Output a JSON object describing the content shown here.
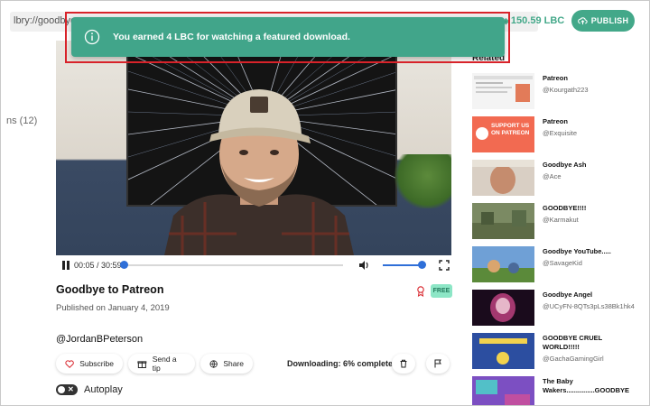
{
  "header": {
    "url": "lbry://goodbye",
    "balance": "150.59 LBC",
    "publish_label": "PUBLISH"
  },
  "sidebar": {
    "count_text": "ns (12)"
  },
  "toast": {
    "message": "You earned 4 LBC for watching a featured download."
  },
  "player": {
    "time": "00:05 / 30:59",
    "progress_fraction": 0.003,
    "volume_fraction": 0.9
  },
  "video_info": {
    "title": "Goodbye to Patreon",
    "published": "Published on January 4, 2019",
    "free_badge": "FREE",
    "channel": "@JordanBPeterson"
  },
  "actions": {
    "subscribe_label": "Subscribe",
    "tip_label": "Send a tip",
    "share_label": "Share",
    "download_status": "Downloading: 6% complete"
  },
  "autoplay_label": "Autoplay",
  "related": {
    "heading": "Related",
    "items": [
      {
        "title": "Patreon",
        "channel": "@Kourgath223"
      },
      {
        "title": "Patreon",
        "channel": "@Exquisite",
        "thumb_text": "SUPPORT US ON PATREON"
      },
      {
        "title": "Goodbye Ash",
        "channel": "@Ace"
      },
      {
        "title": "GOODBYE!!!!",
        "channel": "@Karmakut"
      },
      {
        "title": "Goodbye YouTube.....",
        "channel": "@SavageKid"
      },
      {
        "title": "Goodbye Angel",
        "channel": "@UCyFN-8QTs3pLs38Bk1hk4"
      },
      {
        "title": "GOODBYE CRUEL WORLD!!!!!",
        "channel": "@GachaGamingGirl"
      },
      {
        "title": "The Baby Wakers...............GOODBYE",
        "channel": ""
      }
    ]
  },
  "colors": {
    "accent": "#41a58a",
    "highlight": "#d8232a",
    "player_blue": "#2f6fd8"
  }
}
